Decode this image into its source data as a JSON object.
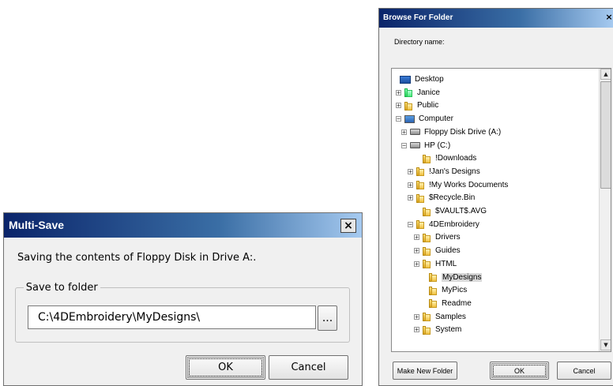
{
  "multisave": {
    "title": "Multi-Save",
    "message": "Saving the contents of Floppy Disk in Drive A:.",
    "group_label": "Save to folder",
    "path_value": "C:\\4DEmbroidery\\MyDesigns\\",
    "browse_label": "...",
    "ok_label": "OK",
    "cancel_label": "Cancel",
    "close_label": "×"
  },
  "browse": {
    "title": "Browse For Folder",
    "directory_label": "Directory name:",
    "close_label": "×",
    "make_new_folder_label": "Make New Folder",
    "ok_label": "OK",
    "cancel_label": "Cancel",
    "tree": [
      {
        "label": "Desktop",
        "icon": "desktop-icon",
        "expander": ""
      },
      {
        "label": "Janice",
        "icon": "user-folder-icon",
        "expander": "+"
      },
      {
        "label": "Public",
        "icon": "folder-icon",
        "expander": "+"
      },
      {
        "label": "Computer",
        "icon": "computer-icon",
        "expander": "-"
      },
      {
        "label": "Floppy Disk Drive (A:)",
        "icon": "floppy-drive-icon",
        "expander": "+"
      },
      {
        "label": "HP (C:)",
        "icon": "hard-drive-icon",
        "expander": "-"
      },
      {
        "label": "!Downloads",
        "icon": "folder-icon",
        "expander": ""
      },
      {
        "label": "!Jan's Designs",
        "icon": "folder-icon",
        "expander": "+"
      },
      {
        "label": "!My Works Documents",
        "icon": "folder-icon",
        "expander": "+"
      },
      {
        "label": "$Recycle.Bin",
        "icon": "folder-icon",
        "expander": "+"
      },
      {
        "label": "$VAULT$.AVG",
        "icon": "folder-icon",
        "expander": ""
      },
      {
        "label": "4DEmbroidery",
        "icon": "folder-icon",
        "expander": "-"
      },
      {
        "label": "Drivers",
        "icon": "folder-icon",
        "expander": "+"
      },
      {
        "label": "Guides",
        "icon": "folder-icon",
        "expander": "+"
      },
      {
        "label": "HTML",
        "icon": "folder-icon",
        "expander": "+"
      },
      {
        "label": "MyDesigns",
        "icon": "folder-icon",
        "expander": "",
        "selected": true
      },
      {
        "label": "MyPics",
        "icon": "folder-icon",
        "expander": ""
      },
      {
        "label": "Readme",
        "icon": "folder-icon",
        "expander": ""
      },
      {
        "label": "Samples",
        "icon": "folder-icon",
        "expander": "+"
      },
      {
        "label": "System",
        "icon": "folder-icon",
        "expander": "+"
      }
    ]
  }
}
